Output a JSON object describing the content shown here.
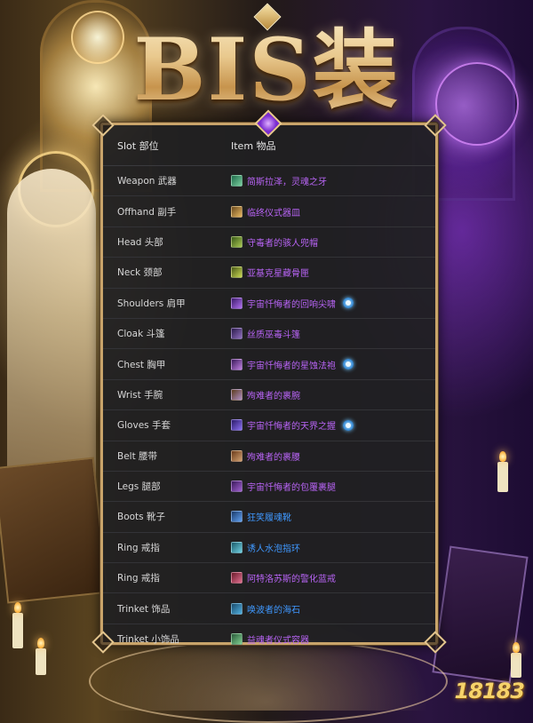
{
  "title": "BIS装",
  "table": {
    "headers": {
      "slot": "Slot 部位",
      "item": "Item 物品"
    },
    "rows": [
      {
        "slot": "Weapon 武器",
        "item": "简斯拉泽，灵魂之牙",
        "quality": "epic",
        "icon": "weapon-item-icon",
        "icon_colors": [
          "#1f6a4a",
          "#7ad0a0"
        ],
        "tier": false
      },
      {
        "slot": "Offhand 副手",
        "item": "临终仪式器皿",
        "quality": "epic",
        "icon": "offhand-item-icon",
        "icon_colors": [
          "#6a4a1f",
          "#e8b860"
        ],
        "tier": false
      },
      {
        "slot": "Head 头部",
        "item": "守毒者的骇人兜帽",
        "quality": "epic",
        "icon": "head-item-icon",
        "icon_colors": [
          "#3a5a1a",
          "#a8c850"
        ],
        "tier": false
      },
      {
        "slot": "Neck 颈部",
        "item": "亚基克星藏骨匣",
        "quality": "epic",
        "icon": "neck-item-icon",
        "icon_colors": [
          "#4a5a1a",
          "#c8d850"
        ],
        "tier": false
      },
      {
        "slot": "Shoulders 肩甲",
        "item": "宇宙忏悔者的回响尖啸",
        "quality": "epic",
        "icon": "shoulders-item-icon",
        "icon_colors": [
          "#3a1a6a",
          "#b070f0"
        ],
        "tier": true
      },
      {
        "slot": "Cloak 斗篷",
        "item": "丝质巫毒斗篷",
        "quality": "epic",
        "icon": "cloak-item-icon",
        "icon_colors": [
          "#2a1a4a",
          "#9070c0"
        ],
        "tier": false
      },
      {
        "slot": "Chest 胸甲",
        "item": "宇宙忏悔者的星蚀法袍",
        "quality": "epic",
        "icon": "chest-item-icon",
        "icon_colors": [
          "#3a1a5a",
          "#c080e0"
        ],
        "tier": true
      },
      {
        "slot": "Wrist 手腕",
        "item": "殉难者的裹腕",
        "quality": "epic",
        "icon": "wrist-item-icon",
        "icon_colors": [
          "#5a3a1a",
          "#b090c8"
        ],
        "tier": false
      },
      {
        "slot": "Gloves 手套",
        "item": "宇宙忏悔者的天界之握",
        "quality": "epic",
        "icon": "gloves-item-icon",
        "icon_colors": [
          "#2a1a6a",
          "#8a70f0"
        ],
        "tier": true
      },
      {
        "slot": "Belt 腰带",
        "item": "殉难者的裹腰",
        "quality": "epic",
        "icon": "belt-item-icon",
        "icon_colors": [
          "#6a3a1a",
          "#d0a070"
        ],
        "tier": false
      },
      {
        "slot": "Legs 腿部",
        "item": "宇宙忏悔者的包覆裹腿",
        "quality": "epic",
        "icon": "legs-item-icon",
        "icon_colors": [
          "#3a1a5a",
          "#a060d0"
        ],
        "tier": false
      },
      {
        "slot": "Boots 靴子",
        "item": "狂笑履魂靴",
        "quality": "rare",
        "icon": "boots-item-icon",
        "icon_colors": [
          "#1a3a6a",
          "#60a0f0"
        ],
        "tier": false
      },
      {
        "slot": "Ring 戒指",
        "item": "诱人水泡指环",
        "quality": "rare",
        "icon": "ring-item-icon",
        "icon_colors": [
          "#1a5a6a",
          "#70d0e0"
        ],
        "tier": false
      },
      {
        "slot": "Ring 戒指",
        "item": "阿特洛苏斯的警化蓝戒",
        "quality": "epic",
        "icon": "ring-item-icon",
        "icon_colors": [
          "#6a1a2a",
          "#e07090"
        ],
        "tier": false
      },
      {
        "slot": "Trinket 饰品",
        "item": "唤波者的海石",
        "quality": "rare",
        "icon": "trinket-item-icon",
        "icon_colors": [
          "#1a4a6a",
          "#50b0e0"
        ],
        "tier": false
      },
      {
        "slot": "Trinket 小饰品",
        "item": "益魂者仪式容器",
        "quality": "epic",
        "icon": "trinket-item-icon",
        "icon_colors": [
          "#2a5a3a",
          "#80d090"
        ],
        "tier": false
      }
    ]
  },
  "colors": {
    "epic": "#b864f5",
    "rare": "#3f98ff",
    "border": "#c9a46a",
    "panel": "#202022"
  },
  "tier_icon": "tier-set-icon",
  "watermark": "18183"
}
